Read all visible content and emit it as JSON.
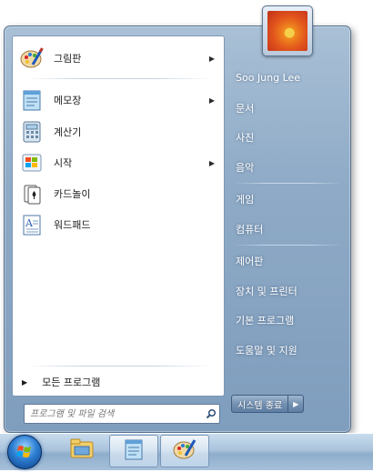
{
  "left_panel": {
    "programs": [
      {
        "label": "그림판",
        "has_submenu": true,
        "icon": "paint-icon"
      },
      {
        "label": "메모장",
        "has_submenu": true,
        "icon": "notepad-icon"
      },
      {
        "label": "계산기",
        "has_submenu": false,
        "icon": "calculator-icon"
      },
      {
        "label": "시작",
        "has_submenu": true,
        "icon": "getting-started-icon"
      },
      {
        "label": "카드놀이",
        "has_submenu": false,
        "icon": "solitaire-icon"
      },
      {
        "label": "워드패드",
        "has_submenu": false,
        "icon": "wordpad-icon"
      }
    ],
    "all_programs": "모든 프로그램",
    "search_placeholder": "프로그램 및 파일 검색"
  },
  "right_panel": {
    "user_name": "Soo Jung Lee",
    "items": [
      "문서",
      "사진",
      "음악",
      "게임",
      "컴퓨터",
      "제어판",
      "장치 및 프린터",
      "기본 프로그램",
      "도움말 및 지원"
    ],
    "shutdown_label": "시스템 종료"
  },
  "taskbar": {
    "pinned": [
      "start-orb",
      "explorer-icon",
      "notepad-icon",
      "paint-icon"
    ]
  },
  "colors": {
    "menu_frame": "#8eaac6",
    "left_panel_bg": "#ffffff",
    "right_text": "#ffffff"
  }
}
